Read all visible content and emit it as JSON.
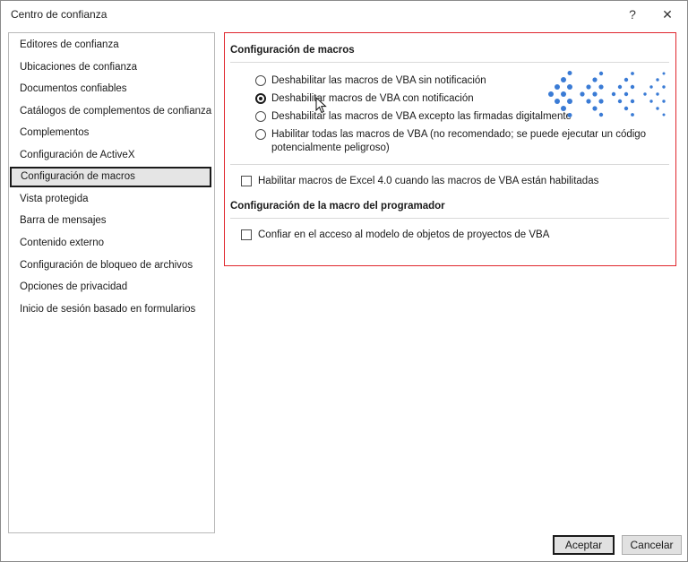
{
  "window": {
    "title": "Centro de confianza",
    "help_glyph": "?",
    "close_glyph": "✕"
  },
  "sidebar": {
    "items": [
      {
        "label": "Editores de confianza"
      },
      {
        "label": "Ubicaciones de confianza"
      },
      {
        "label": "Documentos confiables"
      },
      {
        "label": "Catálogos de complementos de confianza"
      },
      {
        "label": "Complementos"
      },
      {
        "label": "Configuración de ActiveX"
      },
      {
        "label": "Configuración de macros",
        "selected": true
      },
      {
        "label": "Vista protegida"
      },
      {
        "label": "Barra de mensajes"
      },
      {
        "label": "Contenido externo"
      },
      {
        "label": "Configuración de bloqueo de archivos"
      },
      {
        "label": "Opciones de privacidad"
      },
      {
        "label": "Inicio de sesión basado en formularios"
      }
    ]
  },
  "macros": {
    "title": "Configuración de macros",
    "options": [
      {
        "label": "Deshabilitar las macros de VBA sin notificación",
        "checked": false
      },
      {
        "label": "Deshabilitar macros de VBA con notificación",
        "checked": true
      },
      {
        "label": "Deshabilitar las macros de VBA excepto las firmadas digitalmente",
        "checked": false
      },
      {
        "label": "Habilitar todas las macros de VBA (no recomendado; se puede ejecutar un código",
        "label_line2": "potencialmente peligroso)",
        "checked": false
      }
    ],
    "excel4_checkbox": {
      "label": "Habilitar macros de Excel 4.0 cuando las macros de VBA están habilitadas",
      "checked": false
    }
  },
  "developer": {
    "title": "Configuración de la macro del programador",
    "vba_access_checkbox": {
      "label": "Confiar en el acceso al modelo de objetos de proyectos de VBA",
      "checked": false
    }
  },
  "buttons": {
    "ok": "Aceptar",
    "cancel": "Cancelar"
  },
  "colors": {
    "highlight_border": "#e0262d",
    "dots_accent": "#3a7bd5"
  },
  "icons": {
    "decoration": "dot-pattern-graphic",
    "cursor": "mouse-pointer-icon"
  }
}
